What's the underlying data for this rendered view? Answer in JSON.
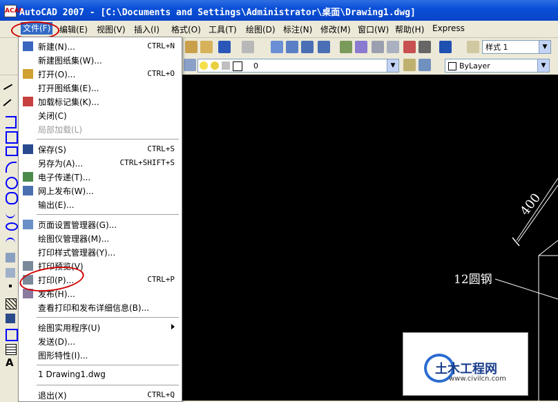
{
  "window": {
    "title": "AutoCAD 2007 - [C:\\Documents and Settings\\Administrator\\桌面\\Drawing1.dwg]",
    "app_icon": "ACAD"
  },
  "menubar": {
    "items": [
      "文件(F)",
      "编辑(E)",
      "视图(V)",
      "插入(I)",
      "格式(O)",
      "工具(T)",
      "绘图(D)",
      "标注(N)",
      "修改(M)",
      "窗口(W)",
      "帮助(H)",
      "Express"
    ]
  },
  "toolbar": {
    "text_style": "样式 1",
    "layer": "0",
    "color": "ByLayer"
  },
  "file_menu": {
    "groups": [
      [
        {
          "label": "新建(N)...",
          "shortcut": "CTRL+N",
          "icon": "new-file-icon"
        },
        {
          "label": "新建图纸集(W)...",
          "shortcut": "",
          "icon": ""
        },
        {
          "label": "打开(O)...",
          "shortcut": "CTRL+O",
          "icon": "open-folder-icon"
        },
        {
          "label": "打开图纸集(E)...",
          "shortcut": "",
          "icon": ""
        },
        {
          "label": "加载标记集(K)...",
          "shortcut": "",
          "icon": "markup-set-icon"
        },
        {
          "label": "关闭(C)",
          "shortcut": "",
          "icon": ""
        },
        {
          "label": "局部加载(L)",
          "shortcut": "",
          "icon": "",
          "disabled": true
        }
      ],
      [
        {
          "label": "保存(S)",
          "shortcut": "CTRL+S",
          "icon": "save-icon"
        },
        {
          "label": "另存为(A)...",
          "shortcut": "CTRL+SHIFT+S",
          "icon": ""
        },
        {
          "label": "电子传递(T)...",
          "shortcut": "",
          "icon": "etransmit-icon"
        },
        {
          "label": "网上发布(W)...",
          "shortcut": "",
          "icon": "publish-web-icon"
        },
        {
          "label": "输出(E)...",
          "shortcut": "",
          "icon": ""
        }
      ],
      [
        {
          "label": "页面设置管理器(G)...",
          "shortcut": "",
          "icon": "page-setup-icon"
        },
        {
          "label": "绘图仪管理器(M)...",
          "shortcut": "",
          "icon": ""
        },
        {
          "label": "打印样式管理器(Y)...",
          "shortcut": "",
          "icon": ""
        },
        {
          "label": "打印预览(V)",
          "shortcut": "",
          "icon": "print-preview-icon"
        },
        {
          "label": "打印(P)...",
          "shortcut": "CTRL+P",
          "icon": "print-icon"
        },
        {
          "label": "发布(H)...",
          "shortcut": "",
          "icon": "publish-icon"
        },
        {
          "label": "查看打印和发布详细信息(B)...",
          "shortcut": "",
          "icon": ""
        }
      ],
      [
        {
          "label": "绘图实用程序(U)",
          "shortcut": "",
          "icon": "",
          "submenu": true
        },
        {
          "label": "发送(D)...",
          "shortcut": "",
          "icon": ""
        },
        {
          "label": "图形特性(I)...",
          "shortcut": "",
          "icon": ""
        }
      ],
      [
        {
          "label": "1 Drawing1.dwg",
          "shortcut": "",
          "icon": ""
        }
      ],
      [
        {
          "label": "退出(X)",
          "shortcut": "CTRL+Q",
          "icon": ""
        }
      ]
    ]
  },
  "drawing": {
    "dimension": "400",
    "label": "12圆钢"
  },
  "watermark": {
    "name": "土木工程网",
    "url": "www.civilcn.com"
  },
  "colors": {
    "titlebar": "#0a4fd8",
    "canvas": "#000000",
    "highlight": "#316ac5",
    "annotation_red": "#d00000"
  }
}
